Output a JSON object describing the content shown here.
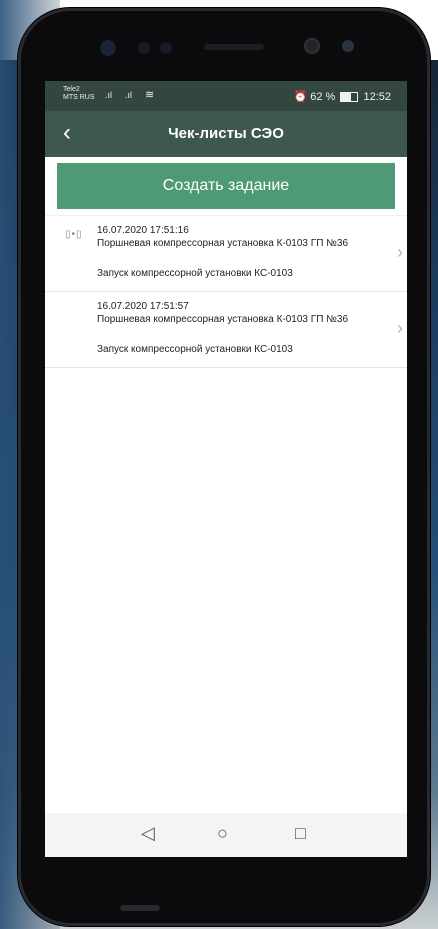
{
  "status": {
    "carrier1": "Tele2",
    "carrier2": "MTS RUS",
    "battery": "62 %",
    "time": "12:52"
  },
  "header": {
    "back_icon": "chevron-left-icon",
    "title": "Чек-листы СЭО"
  },
  "create_button": "Создать задание",
  "items": [
    {
      "icon": "link-icon",
      "datetime": "16.07.2020 17:51:16",
      "name": "Поршневая компрессорная установка К-0103 ГП №36",
      "task": "Запуск компрессорной установки КС-0103"
    },
    {
      "datetime": "16.07.2020 17:51:57",
      "name": "Поршневая компрессорная установка К-0103 ГП №36",
      "task": "Запуск компрессорной установки КС-0103"
    }
  ],
  "colors": {
    "appbar": "#3d584e",
    "statusbar": "#33463f",
    "accent": "#4f9a76"
  }
}
